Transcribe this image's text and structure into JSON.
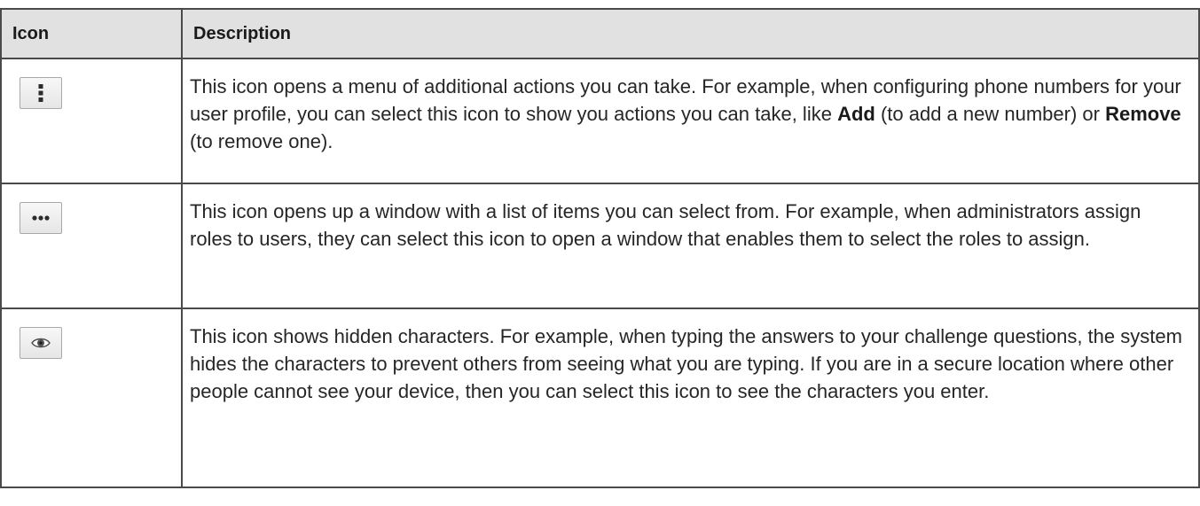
{
  "table": {
    "headers": {
      "icon": "Icon",
      "description": "Description"
    },
    "rows": [
      {
        "icon": "vertical-ellipsis-icon",
        "segments": [
          {
            "text": "This icon opens a menu of additional actions you can take. For example, when configuring phone numbers for your user profile, you can select this icon to show you actions you can take, like ",
            "bold": false
          },
          {
            "text": "Add",
            "bold": true
          },
          {
            "text": " (to add a new number) or ",
            "bold": false
          },
          {
            "text": "Remove",
            "bold": true
          },
          {
            "text": " (to remove one).",
            "bold": false
          }
        ]
      },
      {
        "icon": "horizontal-ellipsis-icon",
        "segments": [
          {
            "text": "This icon opens up a window with a list of items you can select from. For example, when administrators assign roles to users, they can select this icon to open a window that enables them to select the roles to assign.",
            "bold": false
          }
        ]
      },
      {
        "icon": "eye-icon",
        "segments": [
          {
            "text": "This icon shows hidden characters. For example, when typing the answers to your challenge questions, the system hides the characters to prevent others from seeing what you are typing. If you are in a secure location where other people cannot see your device, then you can select this icon to see the characters you enter.",
            "bold": false
          }
        ]
      }
    ]
  }
}
